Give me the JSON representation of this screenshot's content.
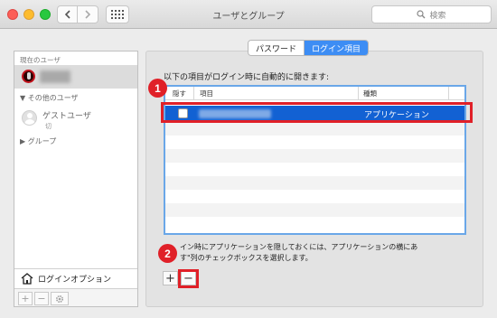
{
  "window": {
    "title": "ユーザとグループ",
    "search_placeholder": "検索"
  },
  "sidebar": {
    "current_user_header": "現在のユーザ",
    "other_users_header": "その他のユーザ",
    "guest_user_name": "ゲストユーザ",
    "guest_user_status": "切",
    "groups_header": "グループ",
    "login_options_label": "ログインオプション"
  },
  "tabs": {
    "password": "パスワード",
    "login_items": "ログイン項目",
    "active": "login_items"
  },
  "main": {
    "heading": "以下の項目がログイン時に自動的に開きます:",
    "columns": [
      "隠す",
      "項目",
      "種類"
    ],
    "rows": [
      {
        "hide": false,
        "item": "",
        "kind": "アプリケーション",
        "selected": true
      }
    ],
    "note_line1": "イン時にアプリケーションを隠しておくには、アプリケーションの横にあ",
    "note_line2": "す\"列のチェックボックスを選択します。",
    "add_label": "+",
    "remove_label": "−"
  },
  "annotations": {
    "badge1": "1",
    "badge2": "2",
    "color": "#e02028"
  },
  "colors": {
    "selection": "#1261d3",
    "accent": "#3d8df4"
  }
}
